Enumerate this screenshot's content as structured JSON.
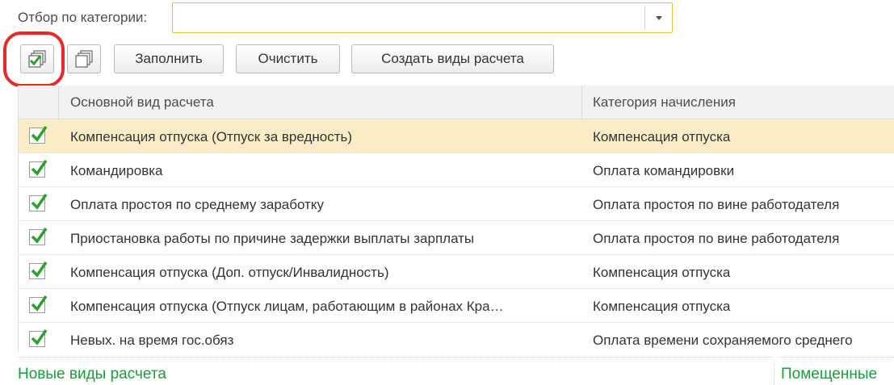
{
  "filter": {
    "label": "Отбор по категории:",
    "value": ""
  },
  "toolbar": {
    "check_all_icon": "check-all-icon",
    "uncheck_all_icon": "uncheck-all-icon",
    "fill_label": "Заполнить",
    "clear_label": "Очистить",
    "create_label": "Создать виды расчета"
  },
  "grid": {
    "columns": [
      "Основной вид расчета",
      "Категория начисления"
    ],
    "rows": [
      {
        "checked": true,
        "name": "Компенсация отпуска (Отпуск за вредность)",
        "category": "Компенсация отпуска"
      },
      {
        "checked": true,
        "name": "Командировка",
        "category": "Оплата командировки"
      },
      {
        "checked": true,
        "name": "Оплата простоя по среднему заработку",
        "category": "Оплата простоя по вине работодателя"
      },
      {
        "checked": true,
        "name": "Приостановка работы по причине задержки выплаты зарплаты",
        "category": "Оплата простоя по вине работодателя"
      },
      {
        "checked": true,
        "name": "Компенсация отпуска (Доп. отпуск/Инвалидность)",
        "category": "Компенсация отпуска"
      },
      {
        "checked": true,
        "name": "Компенсация отпуска (Отпуск лицам, работающим в районах Кра…",
        "category": "Компенсация отпуска"
      },
      {
        "checked": true,
        "name": "Невых. на время гос.обяз",
        "category": "Оплата времени сохраняемого среднего"
      }
    ]
  },
  "footer": {
    "new_link": "Новые виды расчета",
    "placed_link": "Помещенные"
  },
  "colors": {
    "accent": "#e8c33e",
    "selected_row": "#faecc6",
    "link": "#1f9a3e",
    "check": "#2ca02c",
    "highlight": "#e52a2a"
  }
}
